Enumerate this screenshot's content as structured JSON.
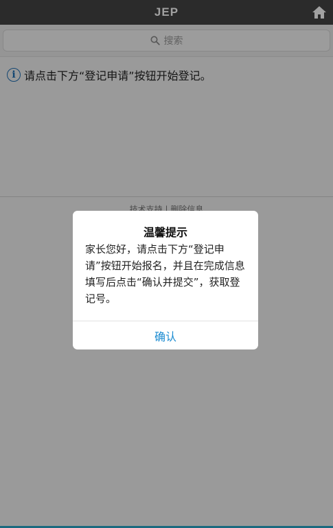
{
  "header": {
    "title": "JEP",
    "home_icon": "home-icon"
  },
  "search": {
    "label": "搜索",
    "icon": "search-icon"
  },
  "content": {
    "notice": "请点击下方“登记申请”按钮开始登记。",
    "info_icon": "info-icon"
  },
  "footer": {
    "links": "技术支持 | 删除信息"
  },
  "dialog": {
    "title": "温馨提示",
    "message": "家长您好，请点击下方“登记申请”按钮开始报名，并且在完成信息填写后点击“确认并提交”，获取登记号。",
    "confirm_label": "确认"
  },
  "colors": {
    "header": "#454545",
    "accent": "#1a8bd1",
    "info": "#1f6fb5"
  }
}
